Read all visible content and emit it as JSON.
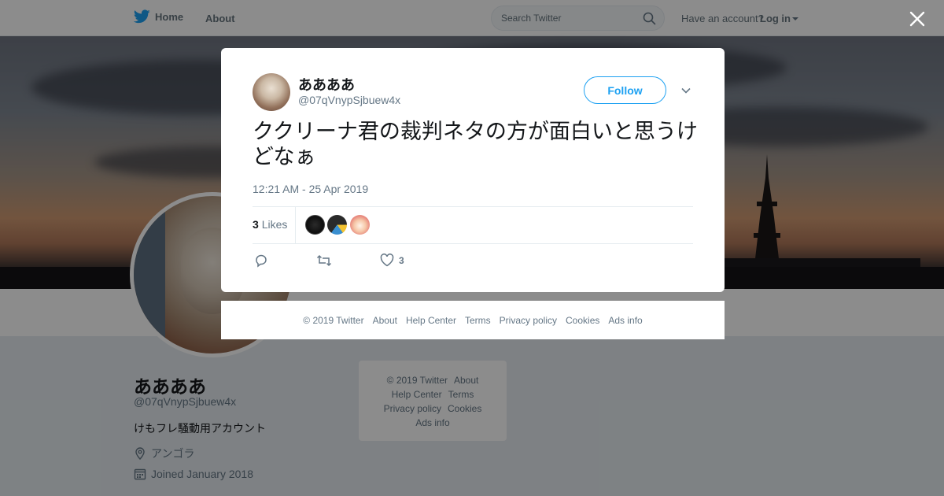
{
  "nav": {
    "home_label": "Home",
    "about_label": "About",
    "search_placeholder": "Search Twitter",
    "have_account": "Have an account?",
    "login_label": "Log in"
  },
  "profile": {
    "name": "ああああ",
    "handle": "@07qVnypSjbuew4x",
    "bio": "けもフレ騒動用アカウント",
    "location": "アンゴラ",
    "joined": "Joined January 2018"
  },
  "side_footer": {
    "line1": [
      "© 2019 Twitter",
      "About"
    ],
    "line2": [
      "Help Center",
      "Terms"
    ],
    "line3": [
      "Privacy policy",
      "Cookies"
    ],
    "line4": [
      "Ads info"
    ]
  },
  "tweet": {
    "author_name": "ああああ",
    "author_handle": "@07qVnypSjbuew4x",
    "follow_label": "Follow",
    "text": "ククリーナ君の裁判ネタの方が面白いと思うけどなぁ",
    "timestamp": "12:21 AM - 25 Apr 2019",
    "likes_count": "3",
    "likes_label": "Likes",
    "like_action_count": "3"
  },
  "modal_footer": {
    "copyright": "© 2019 Twitter",
    "about": "About",
    "help": "Help Center",
    "terms": "Terms",
    "privacy": "Privacy policy",
    "cookies": "Cookies",
    "ads": "Ads info"
  },
  "colors": {
    "brand": "#1da1f2",
    "muted": "#657786",
    "text": "#14171a"
  }
}
